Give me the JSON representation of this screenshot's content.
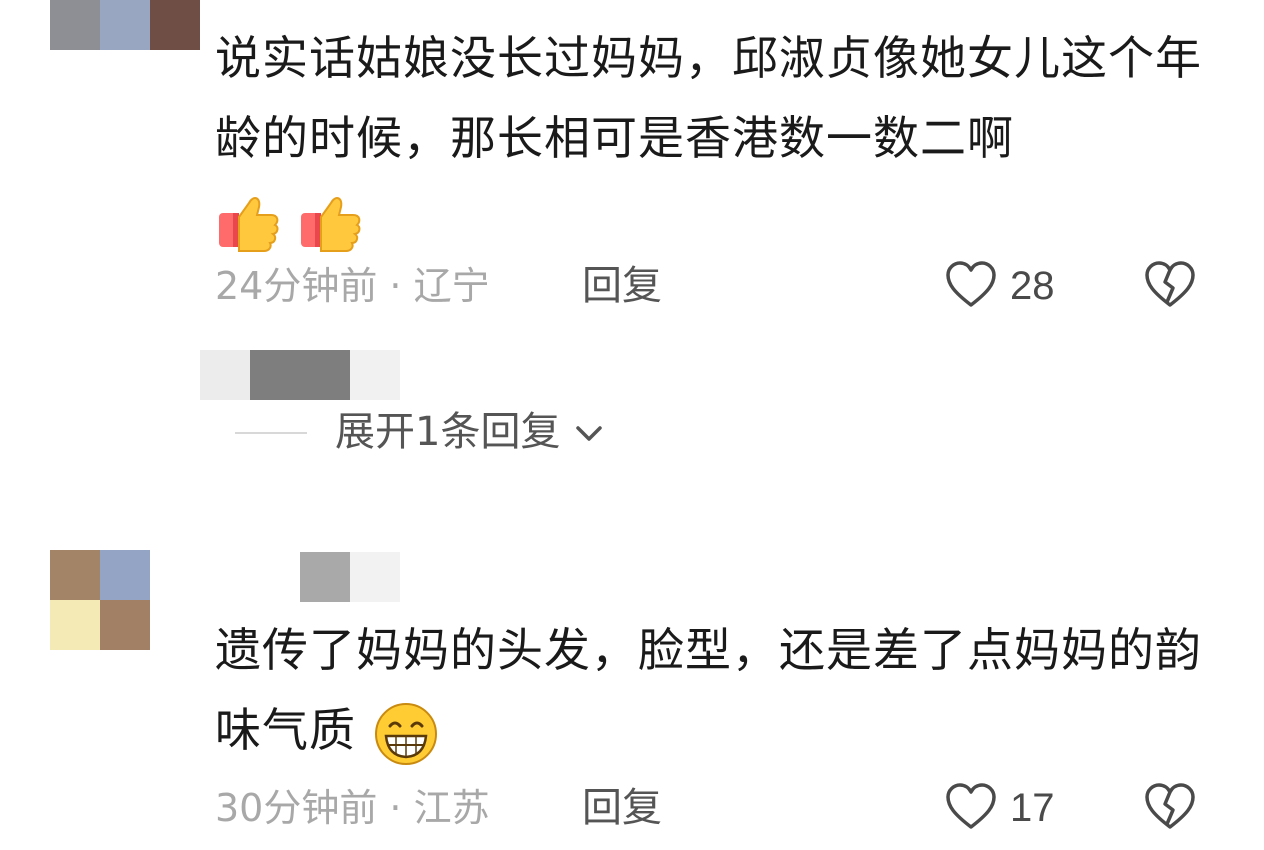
{
  "comments": [
    {
      "text": "说实话姑娘没长过妈妈，邱淑贞像她女儿这个年龄的时候，那长相可是香港数一数二啊",
      "emojis": [
        "thumbs-up",
        "thumbs-up"
      ],
      "time": "24分钟前",
      "location": "辽宁",
      "meta": "24分钟前 · 辽宁",
      "reply_label": "回复",
      "likes": "28",
      "expand_replies": "展开1条回复"
    },
    {
      "text": "遗传了妈妈的头发，脸型，还是差了点妈妈的韵味气质",
      "emojis": [
        "grinning-face"
      ],
      "time": "30分钟前",
      "location": "江苏",
      "meta": "30分钟前 · 江苏",
      "reply_label": "回复",
      "likes": "17"
    }
  ],
  "icons": {
    "like": "heart-outline-icon",
    "dislike": "broken-heart-icon",
    "expand": "chevron-down-icon"
  },
  "colors": {
    "text": "#1a1a1a",
    "meta": "#a8a8a8",
    "action": "#555555"
  }
}
